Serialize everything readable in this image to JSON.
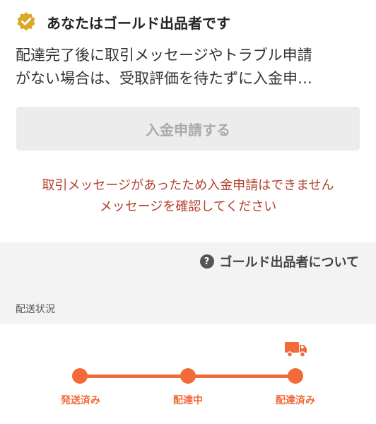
{
  "gold_seller": {
    "title": "あなたはゴールド出品者です",
    "badge_icon": "verified-badge-icon",
    "description_lines": [
      "配達完了後に取引メッセージやトラブル申請",
      "がない場合は、受取評価を待たずに入金申…"
    ],
    "apply_button_label": "入金申請する",
    "warning_lines": [
      "取引メッセージがあったため入金申請はできません",
      "メッセージを確認してください"
    ],
    "about_link_label": "ゴールド出品者について",
    "help_icon_glyph": "?"
  },
  "shipping": {
    "section_label": "配送状況",
    "steps": [
      {
        "label": "発送済み"
      },
      {
        "label": "配達中"
      },
      {
        "label": "配達済み"
      }
    ],
    "current_step_icon": "truck-icon"
  },
  "colors": {
    "accent": "#f26a3a",
    "warning": "#b3412d",
    "gold": "#d9a825",
    "button_bg": "#ececec"
  }
}
